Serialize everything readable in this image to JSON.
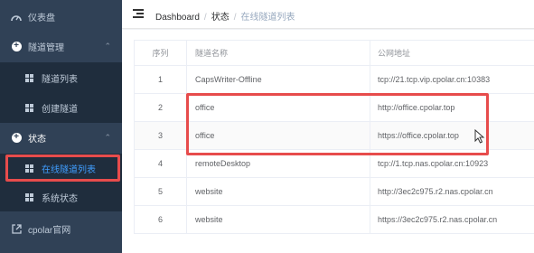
{
  "sidebar": {
    "items": [
      {
        "label": "仪表盘",
        "icon": "dashboard-icon"
      },
      {
        "label": "隧道管理",
        "icon": "plus-circle-icon",
        "expanded": true
      },
      {
        "label": "隧道列表",
        "icon": "grid-icon"
      },
      {
        "label": "创建隧道",
        "icon": "grid-icon"
      },
      {
        "label": "状态",
        "icon": "plus-circle-icon",
        "expanded": true
      },
      {
        "label": "在线隧道列表",
        "icon": "grid-icon",
        "active": true
      },
      {
        "label": "系统状态",
        "icon": "grid-icon"
      },
      {
        "label": "cpolar官网",
        "icon": "external-link-icon"
      }
    ]
  },
  "breadcrumb": {
    "items": [
      "Dashboard",
      "状态",
      "在线隧道列表"
    ],
    "separator": "/"
  },
  "table": {
    "headers": [
      "序列",
      "隧道名称",
      "公网地址"
    ],
    "rows": [
      {
        "idx": "1",
        "name": "CapsWriter-Offline",
        "url": "tcp://21.tcp.vip.cpolar.cn:10383"
      },
      {
        "idx": "2",
        "name": "office",
        "url": "http://office.cpolar.top"
      },
      {
        "idx": "3",
        "name": "office",
        "url": "https://office.cpolar.top"
      },
      {
        "idx": "4",
        "name": "remoteDesktop",
        "url": "tcp://1.tcp.nas.cpolar.cn:10923"
      },
      {
        "idx": "5",
        "name": "website",
        "url": "http://3ec2c975.r2.nas.cpolar.cn"
      },
      {
        "idx": "6",
        "name": "website",
        "url": "https://3ec2c975.r2.nas.cpolar.cn"
      }
    ]
  },
  "colors": {
    "sidebar_bg": "#304156",
    "submenu_bg": "#1f2d3d",
    "active": "#409eff",
    "highlight": "#e74c4c"
  }
}
